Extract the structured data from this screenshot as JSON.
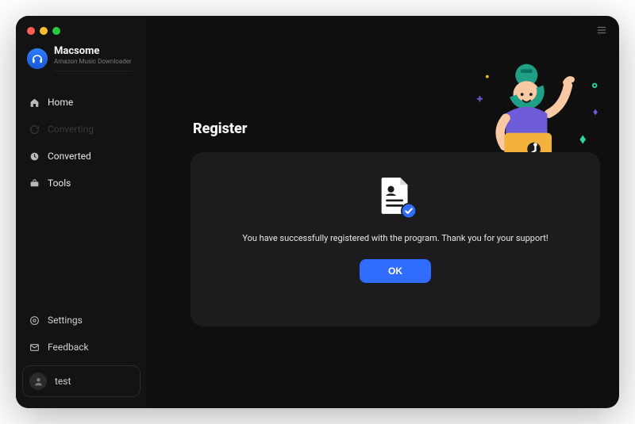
{
  "brand": {
    "name": "Macsome",
    "subtitle": "Amazon Music Downloader"
  },
  "nav": {
    "home": "Home",
    "converting": "Converting",
    "converted": "Converted",
    "tools": "Tools"
  },
  "sidebar_bottom": {
    "settings": "Settings",
    "feedback": "Feedback"
  },
  "account": {
    "name": "test"
  },
  "page": {
    "title": "Register"
  },
  "dialog": {
    "message": "You have successfully registered with the program. Thank you for your support!",
    "ok_label": "OK"
  }
}
